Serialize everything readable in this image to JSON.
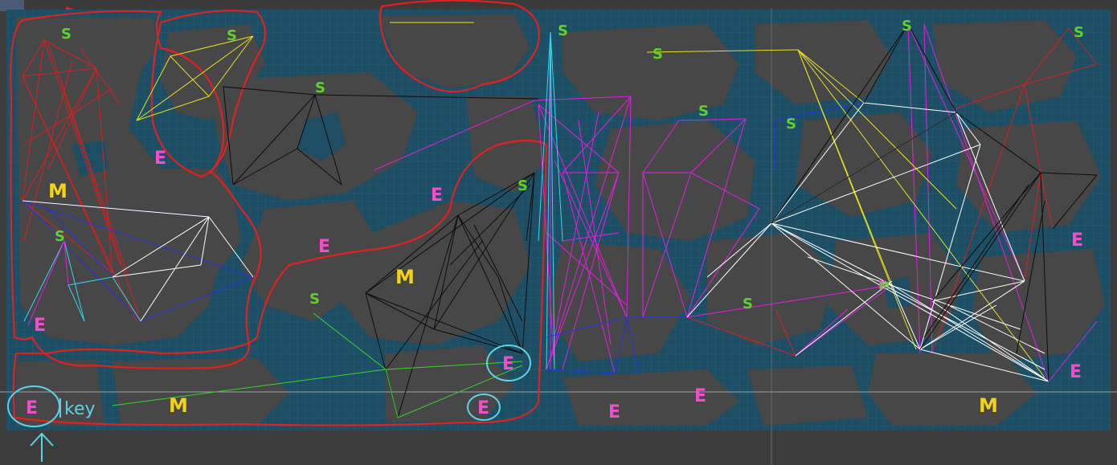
{
  "editor": {
    "scene_colors": {
      "background": "#3c3c3c",
      "floor": "#464646",
      "water": "#1d4e63",
      "grid": "#2b6580"
    }
  },
  "annotations": {
    "key_label": "key",
    "start_markers": [
      "S",
      "S",
      "S",
      "S",
      "S",
      "S",
      "S",
      "S",
      "S",
      "S",
      "S",
      "S",
      "S"
    ],
    "end_markers": [
      "E",
      "E",
      "E",
      "E",
      "E",
      "E",
      "E",
      "E",
      "E",
      "E",
      "E",
      "E"
    ],
    "medium_markers": [
      "M",
      "M",
      "M",
      "M",
      "M"
    ]
  },
  "colors": {
    "region_outline": "#e0211f",
    "start": "#5ed12e",
    "end": "#f04fc9",
    "medium": "#f2d31a",
    "highlight": "#5ad3e6",
    "path_red": "#d62020",
    "path_blue": "#2432e8",
    "path_white": "#ffffff",
    "path_black": "#0c0c0c",
    "path_magenta": "#e020e0",
    "path_cyan": "#31d8ee",
    "path_yellow": "#e8e021",
    "path_green": "#39d62a"
  }
}
